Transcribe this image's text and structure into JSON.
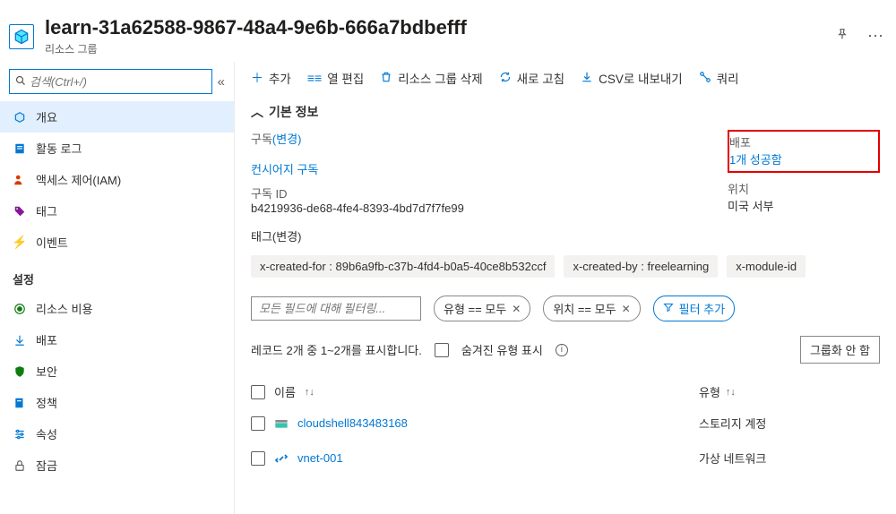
{
  "header": {
    "title": "learn-31a62588-9867-48a4-9e6b-666a7bdbefff",
    "subtitle": "리소스 그룹"
  },
  "sidebar": {
    "search_placeholder": "검색(Ctrl+/)",
    "items": [
      {
        "icon": "cube",
        "label": "개요",
        "active": true
      },
      {
        "icon": "log",
        "label": "활동 로그"
      },
      {
        "icon": "iam",
        "label": "액세스 제어(IAM)"
      },
      {
        "icon": "tag",
        "label": "태그"
      },
      {
        "icon": "event",
        "label": "이벤트"
      }
    ],
    "settings_label": "설정",
    "settings": [
      {
        "icon": "cost",
        "label": "리소스 비용"
      },
      {
        "icon": "deploy",
        "label": "배포"
      },
      {
        "icon": "security",
        "label": "보안"
      },
      {
        "icon": "policy",
        "label": "정책"
      },
      {
        "icon": "props",
        "label": "속성"
      },
      {
        "icon": "lock",
        "label": "잠금"
      }
    ]
  },
  "toolbar": {
    "add": "추가",
    "edit_cols": "열 편집",
    "delete": "리소스 그룹 삭제",
    "refresh": "새로 고침",
    "export": "CSV로 내보내기",
    "query": "쿼리 "
  },
  "basics": {
    "header": "기본 정보",
    "sub_label": "구독",
    "change": "(변경)",
    "sub_value": "컨시어지 구독",
    "sub_id_label": "구독 ID",
    "sub_id_value": "b4219936-de68-4fe4-8393-4bd7d7f7fe99",
    "deploy_label": "배포",
    "deploy_value": "1개 성공함",
    "loc_label": "위치",
    "loc_value": "미국 서부",
    "tags_label": "태그",
    "tags": [
      "x-created-for : 89b6a9fb-c37b-4fd4-b0a5-40ce8b532ccf",
      "x-created-by : freelearning",
      "x-module-id"
    ]
  },
  "filter": {
    "input_placeholder": "모든 필드에 대해 필터링...",
    "type_pill": "유형 == 모두",
    "loc_pill": "위치 == 모두",
    "add_filter": "필터 추가"
  },
  "records": {
    "summary": "레코드 2개 중 1~2개를 표시합니다.",
    "hidden_label": "숨겨진 유형 표시",
    "group_btn": "그룹화 안 함"
  },
  "table": {
    "name_header": "이름",
    "type_header": "유형",
    "rows": [
      {
        "icon": "storage",
        "name": "cloudshell843483168",
        "type": "스토리지 계정"
      },
      {
        "icon": "vnet",
        "name": "vnet-001",
        "type": "가상 네트워크"
      }
    ]
  }
}
